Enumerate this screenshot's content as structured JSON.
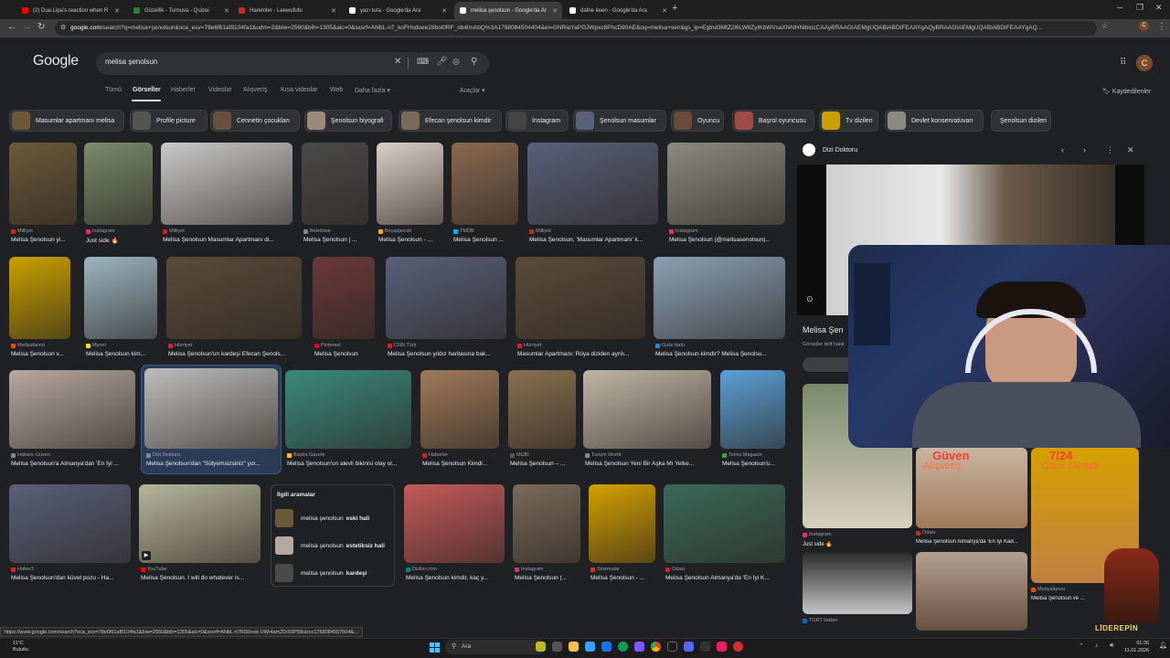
{
  "browser": {
    "tabs": [
      {
        "label": "(2) Dua Lipa's reaction when R",
        "fav": "#ff0000"
      },
      {
        "label": "Güzellik - Turnuva - Quizei",
        "fav": "#2e7d32"
      },
      {
        "label": "Haremler - Leewufufu",
        "fav": "#c62828"
      },
      {
        "label": "yazı tura - Google'da Ara",
        "fav": "#ffffff"
      },
      {
        "label": "melisa şenolsun - Google'da Ar",
        "fav": "#ffffff"
      },
      {
        "label": "dafne keen - Google'da Ara",
        "fav": "#ffffff"
      }
    ],
    "new_tab": "+",
    "url_host": "google.com",
    "url_rest": "/search?q=melisa+şenolsun&sca_esv=78e6f61af8104fa1&udm=2&biw=2560&bih=1305&aic=0&sxsrf=ANbL-n7_koFHsdoee28boi0RF_ob4lmAbQ%3A1768084504404&ei=GNRiaYaPGJWpxc8PhcD90AE&oq=melisa+sen&gs_lp=Egtnd3MtZ2l6LWltZyIKbWVsaXNhIHNlbiocCAAyBRAAGIAEMgUQABiABDIFEAAYgAQyBRAAGIAEMgUQABiABDIFEAAYgAQ..."
  },
  "google": {
    "logo": "Google",
    "query": "melisa şenolsun",
    "nav": [
      "Tümü",
      "Görseller",
      "Haberler",
      "Videolar",
      "Alışveriş",
      "Kısa videolar",
      "Web",
      "Daha fazla ▾"
    ],
    "tools": "Araçlar ▾",
    "saved": "Kaydedilenler",
    "avatar": "C",
    "chips": [
      "Masumlar apartmanı melisa",
      "Profile picture",
      "Cennetin çocukları",
      "Şenolsun biyografi",
      "Efecan şenolsun kimdir",
      "İnstagram",
      "Şenolsun masumlar",
      "Oyuncu",
      "Başrol oyuncusu",
      "Tv dizileri",
      "Devlet konservatuvarı",
      "Şenolsun dizileri"
    ]
  },
  "results": [
    {
      "src": "Milliyet",
      "title": "Melisa Şenolsun yi...",
      "c": "#6b5a3a"
    },
    {
      "src": "Instagram",
      "title": "Just side 🔥",
      "c": "#7a8a6a"
    },
    {
      "src": "Milliyet",
      "title": "Melisa Şenolsun Masumlar Apartmanı di...",
      "c": "#c9c9c9"
    },
    {
      "src": "Beletimai",
      "title": "Melisa Şenolsun | ...",
      "c": "#4a4a4a"
    },
    {
      "src": "Beyazperde",
      "title": "Melisa Şenolsun - ...",
      "c": "#d9cfc5"
    },
    {
      "src": "TMDB",
      "title": "Melisa Şenolsun ...",
      "c": "#8a6a50"
    },
    {
      "src": "Milliyet",
      "title": "Melisa Şenolsun, 'Masumlar Apartmanı' k...",
      "c": "#5a5f7a"
    },
    {
      "src": "Instagram",
      "title": "Melisa Şenolsun (@melisasenolsun)...",
      "c": "#8a8a80"
    },
    {
      "src": "Medyafaresi",
      "title": "Melisa Şenolsun v...",
      "c": "#c9a000"
    },
    {
      "src": "Mynet",
      "title": "Melisa Şenolsun kim...",
      "c": "#9ab5c0"
    },
    {
      "src": "Hürriyet",
      "title": "Melisa Şenolsun'un kardeşi Efecan Şenols...",
      "c": "#5a4a3a"
    },
    {
      "src": "Pinterest",
      "title": "Melisa Şenolsun",
      "c": "#6a3a3a"
    },
    {
      "src": "CNN Türk",
      "title": "Melisa Şenolsun yıldız haritasına bak...",
      "c": "#5a5f7a"
    },
    {
      "src": "Hürriyet",
      "title": "Masumlar Apartmanı: Rüya diziden ayrılı...",
      "c": "#5a4a3a"
    },
    {
      "src": "Gıda Hattı",
      "title": "Melisa Şenolsun kimdir? Melisa Şenolsu...",
      "c": "#8aa0b5"
    },
    {
      "src": "Habere Güven",
      "title": "Melisa Şenolsun'a Almanya'dan 'En İyi ...",
      "c": "#b5a8a0"
    },
    {
      "src": "Dizi Doktoru",
      "title": "Melisa Şenolsun'dan \"Sülyemsizsiniz\" yor...",
      "c": "#bdbdbd"
    },
    {
      "src": "Başka Gazete",
      "title": "Melisa Şenolsun'un alevli bikinisi olay ol...",
      "c": "#3a8a7a"
    },
    {
      "src": "Haberler",
      "title": "Melisa Şenolsun Kimdi...",
      "c": "#a07a5a"
    },
    {
      "src": "MUBI",
      "title": "Melisa Şenolsun – ...",
      "c": "#8a7050"
    },
    {
      "src": "Turizm World",
      "title": "Melisa Şenolsun Yeni Bir Aşka Mı Yelke...",
      "c": "#c0b5a5"
    },
    {
      "src": "Temiz Magazin",
      "title": "Melisa Şenolsun'u...",
      "c": "#5aa0d5"
    },
    {
      "src": "Haber3",
      "title": "Melisa Şenolsun'dan küvet pozu - Ha...",
      "c": "#5a5f7a"
    },
    {
      "src": "YouTube",
      "title": "Melisa Şenolsun. I will do whatever is...",
      "c": "#b5b59a"
    },
    {
      "src": "Diziler.com",
      "title": "Melisa Şenolsun kimdir, kaç y...",
      "c": "#c55a5a"
    },
    {
      "src": "Instagram",
      "title": "Melisa Şenolsun (...",
      "c": "#7a6a5a"
    },
    {
      "src": "Sinemalar",
      "title": "Melisa Şenolsun - ...",
      "c": "#d4a000"
    },
    {
      "src": "Odatv",
      "title": "Melisa Şenolsun Almanya'da 'En İyi K...",
      "c": "#3a6a5a"
    }
  ],
  "related": {
    "heading": "İlgili aramalar",
    "items": [
      {
        "pre": "melisa şenolsun",
        "bold": "eski hali"
      },
      {
        "pre": "melisa şenolsun",
        "bold": "estetiksiz hali"
      },
      {
        "pre": "melisa şenolsun",
        "bold": "kardeşi"
      }
    ]
  },
  "panel": {
    "site": "Dizi Doktoru",
    "title": "Melisa Şen",
    "subtitle": "Görseller telif hakk",
    "results": [
      {
        "src": "Instagram",
        "title": "Just side 🔥"
      },
      {
        "src": "Odatv",
        "title": "Melisa Şenolsun Almanya'da 'En İyi Kad..."
      },
      {
        "src": "Medyafaresi",
        "title": "Melisa Şenolsun ve ..."
      },
      {
        "src": "TGRT Haber",
        "title": ""
      }
    ]
  },
  "overlay": {
    "badge1_big": "Güven",
    "badge1_small": "Alışveriş",
    "badge2_big": "7/24",
    "badge2_small": "Canlı Destek",
    "brand": "LİDEREPİN"
  },
  "status_url": "https://www.google.com/search?sca_esv=78e6f61af8104fa1&biw=2560&bih=1305&aic=0&sxsrf=ANbL-n7R50xvst-UWr4amZ0rX0P58uizxc1768084557604&...",
  "taskbar": {
    "temp": "11°C",
    "weather": "Bulutlu",
    "search": "Ara",
    "time": "01:36",
    "date": "11.01.2026"
  }
}
